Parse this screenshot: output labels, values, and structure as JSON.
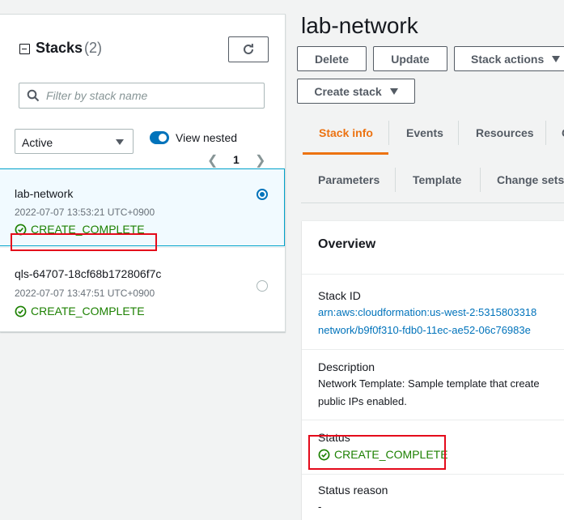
{
  "stacks_panel": {
    "title": "Stacks",
    "count": "(2)",
    "search_placeholder": "Filter by stack name",
    "filter_value": "Active",
    "view_nested_label": "View nested",
    "page": "1",
    "items": [
      {
        "name": "lab-network",
        "time": "2022-07-07 13:53:21 UTC+0900",
        "status": "CREATE_COMPLETE",
        "selected": true
      },
      {
        "name": "qls-64707-18cf68b172806f7c",
        "time": "2022-07-07 13:47:51 UTC+0900",
        "status": "CREATE_COMPLETE",
        "selected": false
      }
    ]
  },
  "detail": {
    "title": "lab-network",
    "buttons": {
      "delete": "Delete",
      "update": "Update",
      "stack_actions": "Stack actions",
      "create_stack": "Create stack"
    },
    "tabs_row1": [
      "Stack info",
      "Events",
      "Resources",
      "C"
    ],
    "tabs_row2": [
      "Parameters",
      "Template",
      "Change sets"
    ],
    "overview": {
      "title": "Overview",
      "stack_id_label": "Stack ID",
      "stack_id_line1": "arn:aws:cloudformation:us-west-2:5315803318",
      "stack_id_line2": "network/b9f0f310-fdb0-11ec-ae52-06c76983e",
      "description_label": "Description",
      "description_line1": "Network Template: Sample template that create",
      "description_line2": "public IPs enabled.",
      "status_label": "Status",
      "status_value": "CREATE_COMPLETE",
      "status_reason_label": "Status reason",
      "status_reason_value": "-"
    }
  },
  "colors": {
    "accent": "#ec7211",
    "link": "#0073bb",
    "success": "#1d8102",
    "highlight": "#e40a1b"
  }
}
